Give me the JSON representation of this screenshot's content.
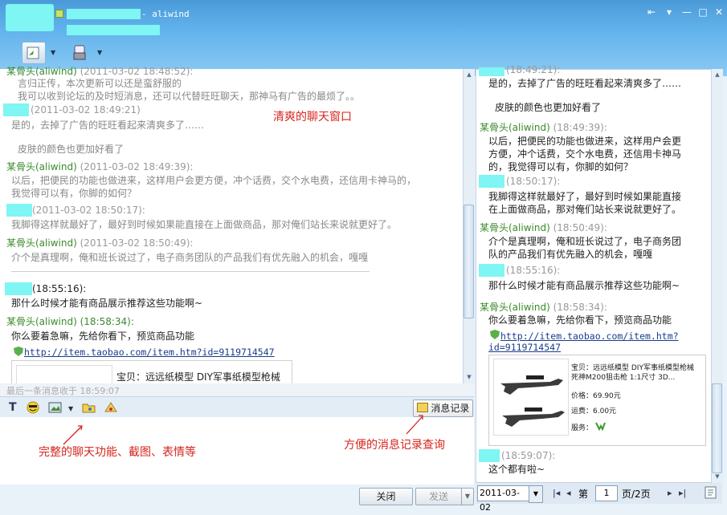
{
  "window": {
    "title_suffix": "- aliwind",
    "close_glyph": "✕",
    "max_glyph": "□",
    "min_glyph": "—",
    "opt_glyph": "▾",
    "back_glyph": "⇤"
  },
  "toolbar": {
    "caret": "▼"
  },
  "left_chat": {
    "messages": [
      {
        "name": "某骨头(aliwind)",
        "time": "(2011-03-02 18:48:52):",
        "lines": [
          "言归正传，本次更新可以还是蛮舒服的",
          "我可以收到论坛的及时短消息，还可以代替旺旺聊天，那神马有广告的最烦了。。"
        ]
      },
      {
        "name": "",
        "time": "(2011-03-02 18:49:21)",
        "lines": [
          "是的，去掉了广告的旺旺看起来清爽多了……",
          "",
          "皮肤的颜色也更加好看了"
        ]
      },
      {
        "name": "某骨头(aliwind)",
        "time": "(2011-03-02 18:49:39):",
        "lines": [
          "以后，把便民的功能也做进来，这样用户会更方便，冲个话费，交个水电费，还信用卡神马的，",
          "我觉得可以有，你脚的如何？"
        ]
      },
      {
        "name": "",
        "time": "(2011-03-02 18:50:17):",
        "lines": [
          "我脚得这样就最好了，最好到时候如果能直接在上面做商品，那对俺们站长来说就更好了。"
        ]
      },
      {
        "name": "某骨头(aliwind)",
        "time": "(2011-03-02 18:50:49):",
        "lines": [
          "介个是真理啊，俺和班长说过了，电子商务团队的产品我们有优先融入的机会，嘎嘎"
        ]
      },
      {
        "name": "",
        "time": "(18:55:16):",
        "lines": [
          "那什么时候才能有商品展示推荐这些功能啊~"
        ]
      },
      {
        "name": "某骨头(aliwind)",
        "time": "(18:58:34):",
        "lines": [
          "你么要着急嘛，先给你看下，预览商品功能"
        ]
      }
    ],
    "link": "http://item.taobao.com/item.htm?id=9119714547",
    "product_title": "宝贝：远远纸模型 DIY军事纸模型枪械",
    "last_msg": "最后一条消息收于 18:59:07",
    "annot_window": "清爽的聊天窗口",
    "annot_features": "完整的聊天功能、截图、表情等",
    "annot_history": "方便的消息记录查询",
    "history_btn": "消息记录",
    "close_btn": "关闭",
    "send_btn": "发送",
    "send_caret": "▼"
  },
  "right_history": {
    "messages": [
      {
        "name": "",
        "time": "(18:49:21):",
        "lines": [
          "是的，去掉了广告的旺旺看起来清爽多了……",
          "",
          "皮肤的颜色也更加好看了"
        ]
      },
      {
        "name": "某骨头(aliwind)",
        "time": "(18:49:39):",
        "lines": [
          "以后，把便民的功能也做进来，这样用户会更",
          "方便，冲个话费，交个水电费，还信用卡神马",
          "的，我觉得可以有，你脚的如何？"
        ]
      },
      {
        "name": "",
        "time": "(18:50:17):",
        "lines": [
          "我脚得这样就最好了，最好到时候如果能直接",
          "在上面做商品，那对俺们站长来说就更好了。"
        ]
      },
      {
        "name": "某骨头(aliwind)",
        "time": "(18:50:49):",
        "lines": [
          "介个是真理啊，俺和班长说过了，电子商务团",
          "队的产品我们有优先融入的机会，嘎嘎"
        ]
      },
      {
        "name": "",
        "time": "(18:55:16):",
        "lines": [
          "那什么时候才能有商品展示推荐这些功能啊~"
        ]
      },
      {
        "name": "某骨头(aliwind)",
        "time": "(18:58:34):",
        "lines": [
          "你么要着急嘛，先给你看下，预览商品功能"
        ]
      }
    ],
    "link1": "http://item.taobao.com/item.htm?",
    "link2": "id=9119714547",
    "product": {
      "title1": "宝贝：远远纸模型 DIY军事纸模型枪械",
      "title2": "死神M200狙击枪 1:1尺寸 3D...",
      "price": "价格：69.90元",
      "shipping": "运费：6.00元",
      "service": "服务："
    },
    "last": {
      "time": "(18:59:07):",
      "line": "这个都有啦~"
    },
    "pager": {
      "date": "2011-03-02",
      "first": "|◂",
      "prev": "◂",
      "di": "第",
      "page": "1",
      "total": "页/2页",
      "next": "▸",
      "last": "▸|"
    }
  }
}
